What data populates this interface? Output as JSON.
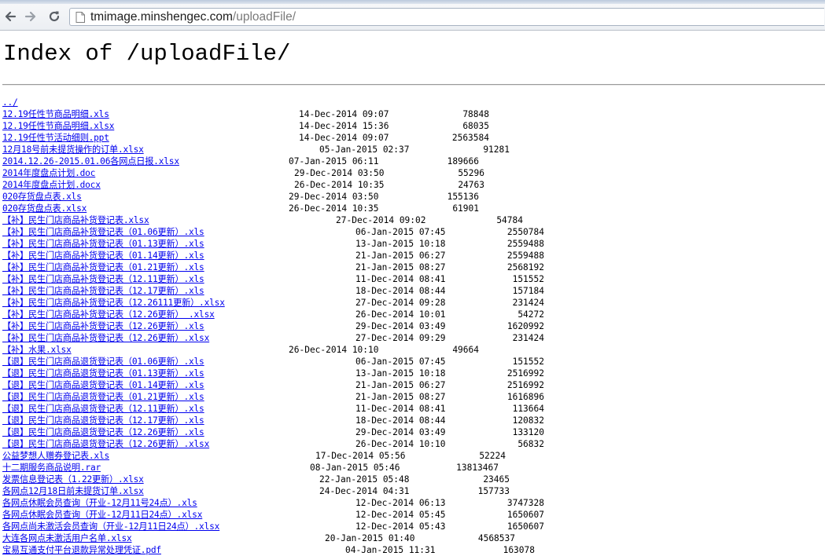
{
  "browser": {
    "url_host": "tmimage.minshengec.com",
    "url_path": "/uploadFile/"
  },
  "page": {
    "title": "Index of /uploadFile/",
    "parent_link": "../"
  },
  "files": [
    {
      "name": "12.19任性节商品明细.xls",
      "date": "14-Dec-2014 09:07",
      "size": "78848"
    },
    {
      "name": "12.19任性节商品明细.xlsx",
      "date": "14-Dec-2014 15:36",
      "size": "68035"
    },
    {
      "name": "12.19任性节活动细则.ppt",
      "date": "14-Dec-2014 09:07",
      "size": "2563584"
    },
    {
      "name": "12月18号前未提货操作的订单.xlsx",
      "date": "05-Jan-2015 02:37",
      "size": "91281"
    },
    {
      "name": "2014.12.26-2015.01.06各网点日报.xlsx",
      "date": "07-Jan-2015 06:11",
      "size": "189666"
    },
    {
      "name": "2014年度盘点计划.doc",
      "date": "29-Dec-2014 03:50",
      "size": "55296"
    },
    {
      "name": "2014年度盘点计划.docx",
      "date": "26-Dec-2014 10:35",
      "size": "24763"
    },
    {
      "name": "020存货盘点表.xls",
      "date": "29-Dec-2014 03:50",
      "size": "155136"
    },
    {
      "name": "020存货盘点表.xlsx",
      "date": "26-Dec-2014 10:35",
      "size": "61901"
    },
    {
      "name": "【补】民生门店商品补货登记表.xlsx",
      "date": "27-Dec-2014 09:02",
      "size": "54784"
    },
    {
      "name": "【补】民生门店商品补货登记表（01.06更新）.xls",
      "date": "06-Jan-2015 07:45",
      "size": "2550784"
    },
    {
      "name": "【补】民生门店商品补货登记表（01.13更新）.xls",
      "date": "13-Jan-2015 10:18",
      "size": "2559488"
    },
    {
      "name": "【补】民生门店商品补货登记表（01.14更新）.xls",
      "date": "21-Jan-2015 06:27",
      "size": "2559488"
    },
    {
      "name": "【补】民生门店商品补货登记表（01.21更新）.xls",
      "date": "21-Jan-2015 08:27",
      "size": "2568192"
    },
    {
      "name": "【补】民生门店商品补货登记表（12.11更新）.xls",
      "date": "11-Dec-2014 08:41",
      "size": "151552"
    },
    {
      "name": "【补】民生门店商品补货登记表（12.17更新）.xls",
      "date": "18-Dec-2014 08:44",
      "size": "157184"
    },
    {
      "name": "【补】民生门店商品补货登记表（12.26111更新）.xlsx",
      "date": "27-Dec-2014 09:28",
      "size": "231424"
    },
    {
      "name": "【补】民生门店商品补货登记表（12.26更新） .xlsx",
      "date": "26-Dec-2014 10:01",
      "size": "54272"
    },
    {
      "name": "【补】民生门店商品补货登记表（12.26更新）.xls",
      "date": "29-Dec-2014 03:49",
      "size": "1620992"
    },
    {
      "name": "【补】民生门店商品补货登记表（12.26更新）.xlsx",
      "date": "27-Dec-2014 09:29",
      "size": "231424"
    },
    {
      "name": "【补】水果.xlsx",
      "date": "26-Dec-2014 10:10",
      "size": "49664"
    },
    {
      "name": "【退】民生门店商品退货登记表（01.06更新）.xls",
      "date": "06-Jan-2015 07:45",
      "size": "151552"
    },
    {
      "name": "【退】民生门店商品退货登记表（01.13更新）.xls",
      "date": "13-Jan-2015 10:18",
      "size": "2516992"
    },
    {
      "name": "【退】民生门店商品退货登记表（01.14更新）.xls",
      "date": "21-Jan-2015 06:27",
      "size": "2516992"
    },
    {
      "name": "【退】民生门店商品退货登记表（01.21更新）.xls",
      "date": "21-Jan-2015 08:27",
      "size": "1616896"
    },
    {
      "name": "【退】民生门店商品退货登记表（12.11更新）.xls",
      "date": "11-Dec-2014 08:41",
      "size": "113664"
    },
    {
      "name": "【退】民生门店商品退货登记表（12.17更新）.xls",
      "date": "18-Dec-2014 08:44",
      "size": "120832"
    },
    {
      "name": "【退】民生门店商品退货登记表（12.26更新）.xls",
      "date": "29-Dec-2014 03:49",
      "size": "133120"
    },
    {
      "name": "【退】民生门店商品退货登记表（12.26更新）.xlsx",
      "date": "26-Dec-2014 10:10",
      "size": "56832"
    },
    {
      "name": "公益梦想人赠券登记表.xls",
      "date": "17-Dec-2014 05:56",
      "size": "52224"
    },
    {
      "name": "十二期服务商品说明.rar",
      "date": "08-Jan-2015 05:46",
      "size": "13813467"
    },
    {
      "name": "发票信息登记表（1.22更新）.xlsx",
      "date": "22-Jan-2015 05:48",
      "size": "23465"
    },
    {
      "name": "各网点12月18日前未提货订单.xlsx",
      "date": "24-Dec-2014 04:31",
      "size": "157733"
    },
    {
      "name": "各网点休眠会员查询（开业-12月11号24点）.xls",
      "date": "12-Dec-2014 06:13",
      "size": "3747328"
    },
    {
      "name": "各网点休眠会员查询（开业-12月11日24点）.xlsx",
      "date": "12-Dec-2014 05:45",
      "size": "1650607"
    },
    {
      "name": "各网点尚未激活会员查询（开业-12月11日24点）.xlsx",
      "date": "12-Dec-2014 05:43",
      "size": "1650607"
    },
    {
      "name": "大连各网点未激活用户名单.xlsx",
      "date": "20-Jan-2015 01:40",
      "size": "4568537"
    },
    {
      "name": "宝易互通支付平台退款异常处理凭证.pdf",
      "date": "04-Jan-2015 11:31",
      "size": "163078"
    }
  ]
}
